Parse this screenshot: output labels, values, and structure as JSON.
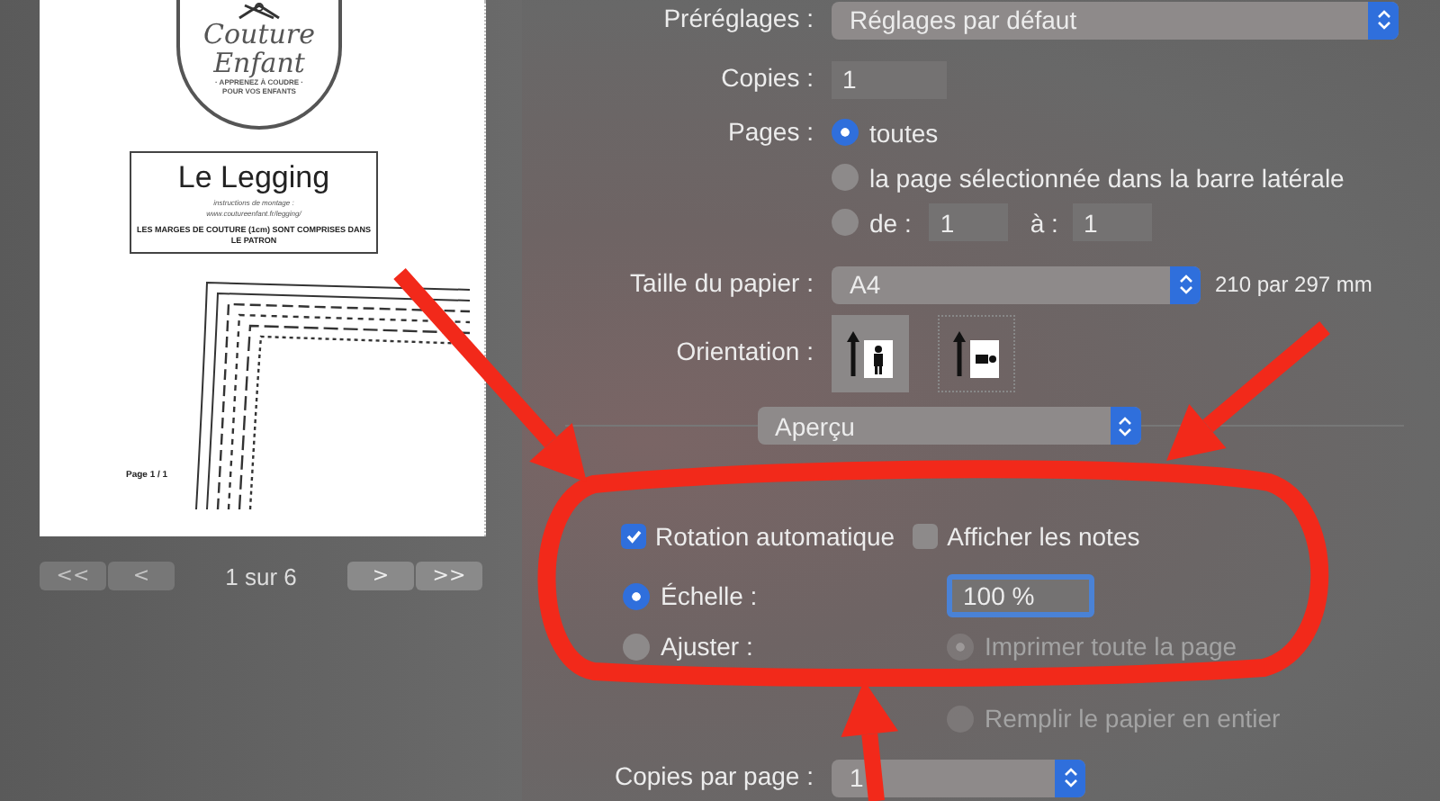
{
  "preview": {
    "logo_lines": [
      "Couture",
      "Enfant"
    ],
    "logo_tagline": [
      "· APPRENEZ À COUDRE ·",
      "POUR VOS ENFANTS"
    ],
    "title": "Le Legging",
    "subtitle": [
      "instructions de montage :",
      "www.coutureenfant.fr/legging/"
    ],
    "notice": "LES MARGES DE COUTURE (1cm) SONT COMPRISES DANS LE PATRON",
    "footer": "Page 1 / 1"
  },
  "page_nav": {
    "buttons": [
      {
        "label": "<<",
        "disabled": true
      },
      {
        "label": "<",
        "disabled": true
      },
      {
        "label": ">",
        "disabled": false
      },
      {
        "label": ">>",
        "disabled": false
      }
    ],
    "counter": "1 sur 6"
  },
  "settings": {
    "presets": {
      "label": "Préréglages :",
      "value": "Réglages par défaut"
    },
    "copies": {
      "label": "Copies :",
      "value": "1"
    },
    "pages": {
      "label": "Pages :",
      "options": [
        {
          "kind": "plain",
          "label": "toutes",
          "selected": true
        },
        {
          "kind": "plain",
          "label": "la page sélectionnée dans la barre latérale",
          "selected": false
        },
        {
          "kind": "range",
          "label": "de :",
          "selected": false,
          "from": "1",
          "to_label": "à :",
          "to": "1"
        }
      ]
    },
    "paper": {
      "label": "Taille du papier :",
      "value": "A4",
      "size": "210 par 297 mm"
    },
    "orientation": {
      "label": "Orientation :",
      "options": [
        {
          "kind": "portrait",
          "selected": true
        },
        {
          "kind": "landscape",
          "selected": false
        }
      ]
    },
    "section": "Aperçu",
    "checkboxes": [
      {
        "label": "Rotation automatique",
        "checked": true
      },
      {
        "label": "Afficher les notes",
        "checked": false
      }
    ],
    "scale": {
      "label": "Échelle :",
      "selected": true,
      "value": "100 %"
    },
    "fit": {
      "label": "Ajuster :",
      "selected": false,
      "options": [
        {
          "label": "Imprimer toute la page",
          "selected": true,
          "disabled": true
        },
        {
          "label": "Remplir le papier en entier",
          "selected": false,
          "disabled": true
        }
      ]
    },
    "copies_per_page": {
      "label": "Copies par page :",
      "value": "1"
    }
  }
}
